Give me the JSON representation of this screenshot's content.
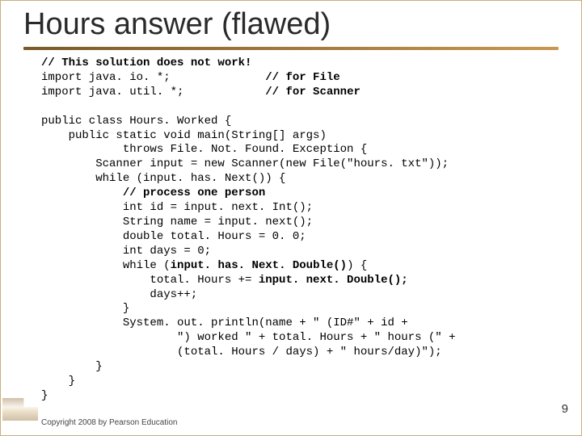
{
  "title": "Hours answer (flawed)",
  "code": {
    "l01": "// This solution does not work!",
    "l02a": "import java. io. *;              ",
    "l02b": "// for File",
    "l03a": "import java. util. *;            ",
    "l03b": "// for Scanner",
    "l04": "",
    "l05": "public class Hours. Worked {",
    "l06": "    public static void main(String[] args)",
    "l07": "            throws File. Not. Found. Exception {",
    "l08": "        Scanner input = new Scanner(new File(\"hours. txt\"));",
    "l09": "        while (input. has. Next()) {",
    "l10": "            // process one person",
    "l11": "            int id = input. next. Int();",
    "l12": "            String name = input. next();",
    "l13": "            double total. Hours = 0. 0;",
    "l14": "            int days = 0;",
    "l15a": "            while (",
    "l15b": "input. has. Next. Double()",
    "l15c": ") {",
    "l16a": "                total. Hours += ",
    "l16b": "input. next. Double();",
    "l17": "                days++;",
    "l18": "            }",
    "l19": "            System. out. println(name + \" (ID#\" + id +",
    "l20": "                    \") worked \" + total. Hours + \" hours (\" +",
    "l21": "                    (total. Hours / days) + \" hours/day)\");",
    "l22": "        }",
    "l23": "    }",
    "l24": "}"
  },
  "page_number": "9",
  "copyright": "Copyright 2008 by Pearson Education"
}
